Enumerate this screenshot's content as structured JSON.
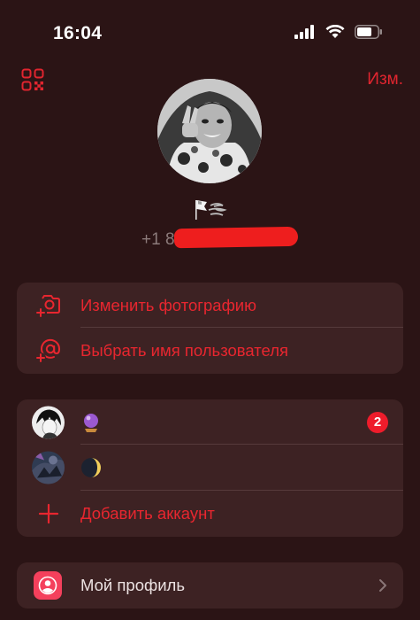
{
  "status_bar": {
    "time": "16:04"
  },
  "header": {
    "edit_label": "Изм."
  },
  "profile": {
    "phone": "+1 8"
  },
  "actions": [
    {
      "label": "Изменить фотографию",
      "icon": "camera-icon"
    },
    {
      "label": "Выбрать имя пользователя",
      "icon": "at-sign-icon"
    }
  ],
  "accounts": {
    "items": [
      {
        "badge": "2",
        "emoji": "crystal-ball-emoji"
      },
      {
        "emoji": "moon-emoji"
      }
    ],
    "add_label": "Добавить аккаунт"
  },
  "menu": {
    "my_profile": "Мой профиль"
  },
  "colors": {
    "accent": "#e8262f",
    "background": "#2b1415",
    "card": "#3d2223",
    "badge": "#ee1c2b",
    "profile_icon": "#f4405c"
  }
}
